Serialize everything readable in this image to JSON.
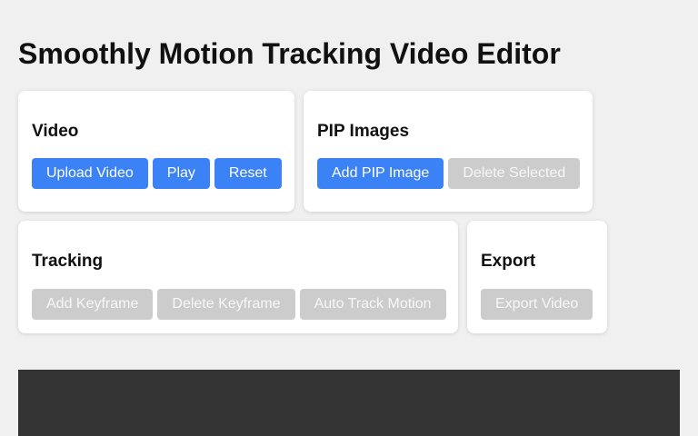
{
  "app": {
    "title": "Smoothly Motion Tracking Video Editor"
  },
  "panels": {
    "video": {
      "title": "Video",
      "buttons": {
        "upload": "Upload Video",
        "play": "Play",
        "reset": "Reset"
      }
    },
    "pip": {
      "title": "PIP Images",
      "buttons": {
        "add": "Add PIP Image",
        "delete": "Delete Selected"
      }
    },
    "tracking": {
      "title": "Tracking",
      "buttons": {
        "add_keyframe": "Add Keyframe",
        "delete_keyframe": "Delete Keyframe",
        "auto_track": "Auto Track Motion"
      }
    },
    "export": {
      "title": "Export",
      "buttons": {
        "export_video": "Export Video"
      }
    }
  },
  "colors": {
    "background": "#f0f0f0",
    "panel": "#ffffff",
    "primary_button": "#3b82f6",
    "disabled_button": "#cccccc",
    "video_canvas": "#333333"
  }
}
